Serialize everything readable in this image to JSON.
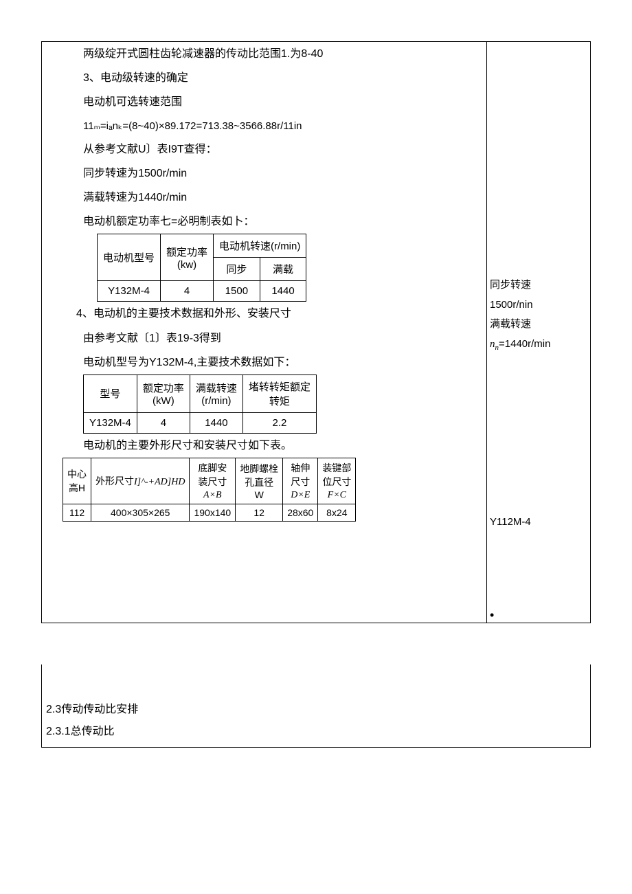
{
  "top": {
    "line1": "两级绽开式圆柱齿轮减速器的传动比范围1.为8-40",
    "h3": "3、电动级转速的确定",
    "line2": "电动机可选转速范围",
    "formula": "11ₘ=iₐnₖ=(8~40)×89.172=713.38~3566.88r/11in",
    "line3": "从参考文献U〕表I9T查得：",
    "line4": "同步转速为1500r/min",
    "line5": "满载转速为1440r/min",
    "line6": "电动机额定功率七=必明制表如卜："
  },
  "table1": {
    "h_model": "电动机型号",
    "h_power": "额定功率",
    "h_power_unit": "(kw)",
    "h_speed": "电动机转速(r/min)",
    "h_sync": "同步",
    "h_full": "满载",
    "r_model": "Y132M-4",
    "r_power": "4",
    "r_sync": "1500",
    "r_full": "1440"
  },
  "mid": {
    "h4": "4、电动机的主要技术数据和外形、安装尺寸",
    "line1": "由参考文献〔1〕表19-3得到",
    "line2": "电动机型号为Y132M-4,主要技术数据如下："
  },
  "table2": {
    "h_model": "型号",
    "h_power": "额定功率",
    "h_power_unit": "(kW)",
    "h_full": "满载转速",
    "h_full_unit": "(r/min)",
    "h_torque1": "堵转转矩额定",
    "h_torque2": "转矩",
    "r_model": "Y132M-4",
    "r_power": "4",
    "r_full": "1440",
    "r_torque": "2.2"
  },
  "mid2": {
    "line1": "电动机的主要外形尺寸和安装尺寸如下表。"
  },
  "table3": {
    "h_center1": "中心",
    "h_center2": "高H",
    "h_outline_prefix": "外形尺寸",
    "h_outline_formula": "I]^-+AD]HD",
    "h_foot1": "底脚安",
    "h_foot2": "装尺寸",
    "h_foot3": "A×B",
    "h_bolt1": "地脚螺栓",
    "h_bolt2": "孔直径",
    "h_bolt3": "W",
    "h_shaft1": "轴伸",
    "h_shaft2": "尺寸",
    "h_shaft3": "D×E",
    "h_key1": "装键部",
    "h_key2": "位尺寸",
    "h_key3": "F×C",
    "r_h": "112",
    "r_outline": "400×305×265",
    "r_foot": "190x140",
    "r_bolt": "12",
    "r_shaft": "28x60",
    "r_key": "8x24"
  },
  "side": {
    "sync_label": "同步转速",
    "sync_val": "1500r/nin",
    "full_label": "满载转速",
    "full_val_prefix": "n",
    "full_val_sub": "n",
    "full_val_rest": "=1440r/min",
    "model": "Y112M-4",
    "dot": "•"
  },
  "section": {
    "s1": "2.3传动传动比安排",
    "s2": "2.3.1总传动比"
  }
}
